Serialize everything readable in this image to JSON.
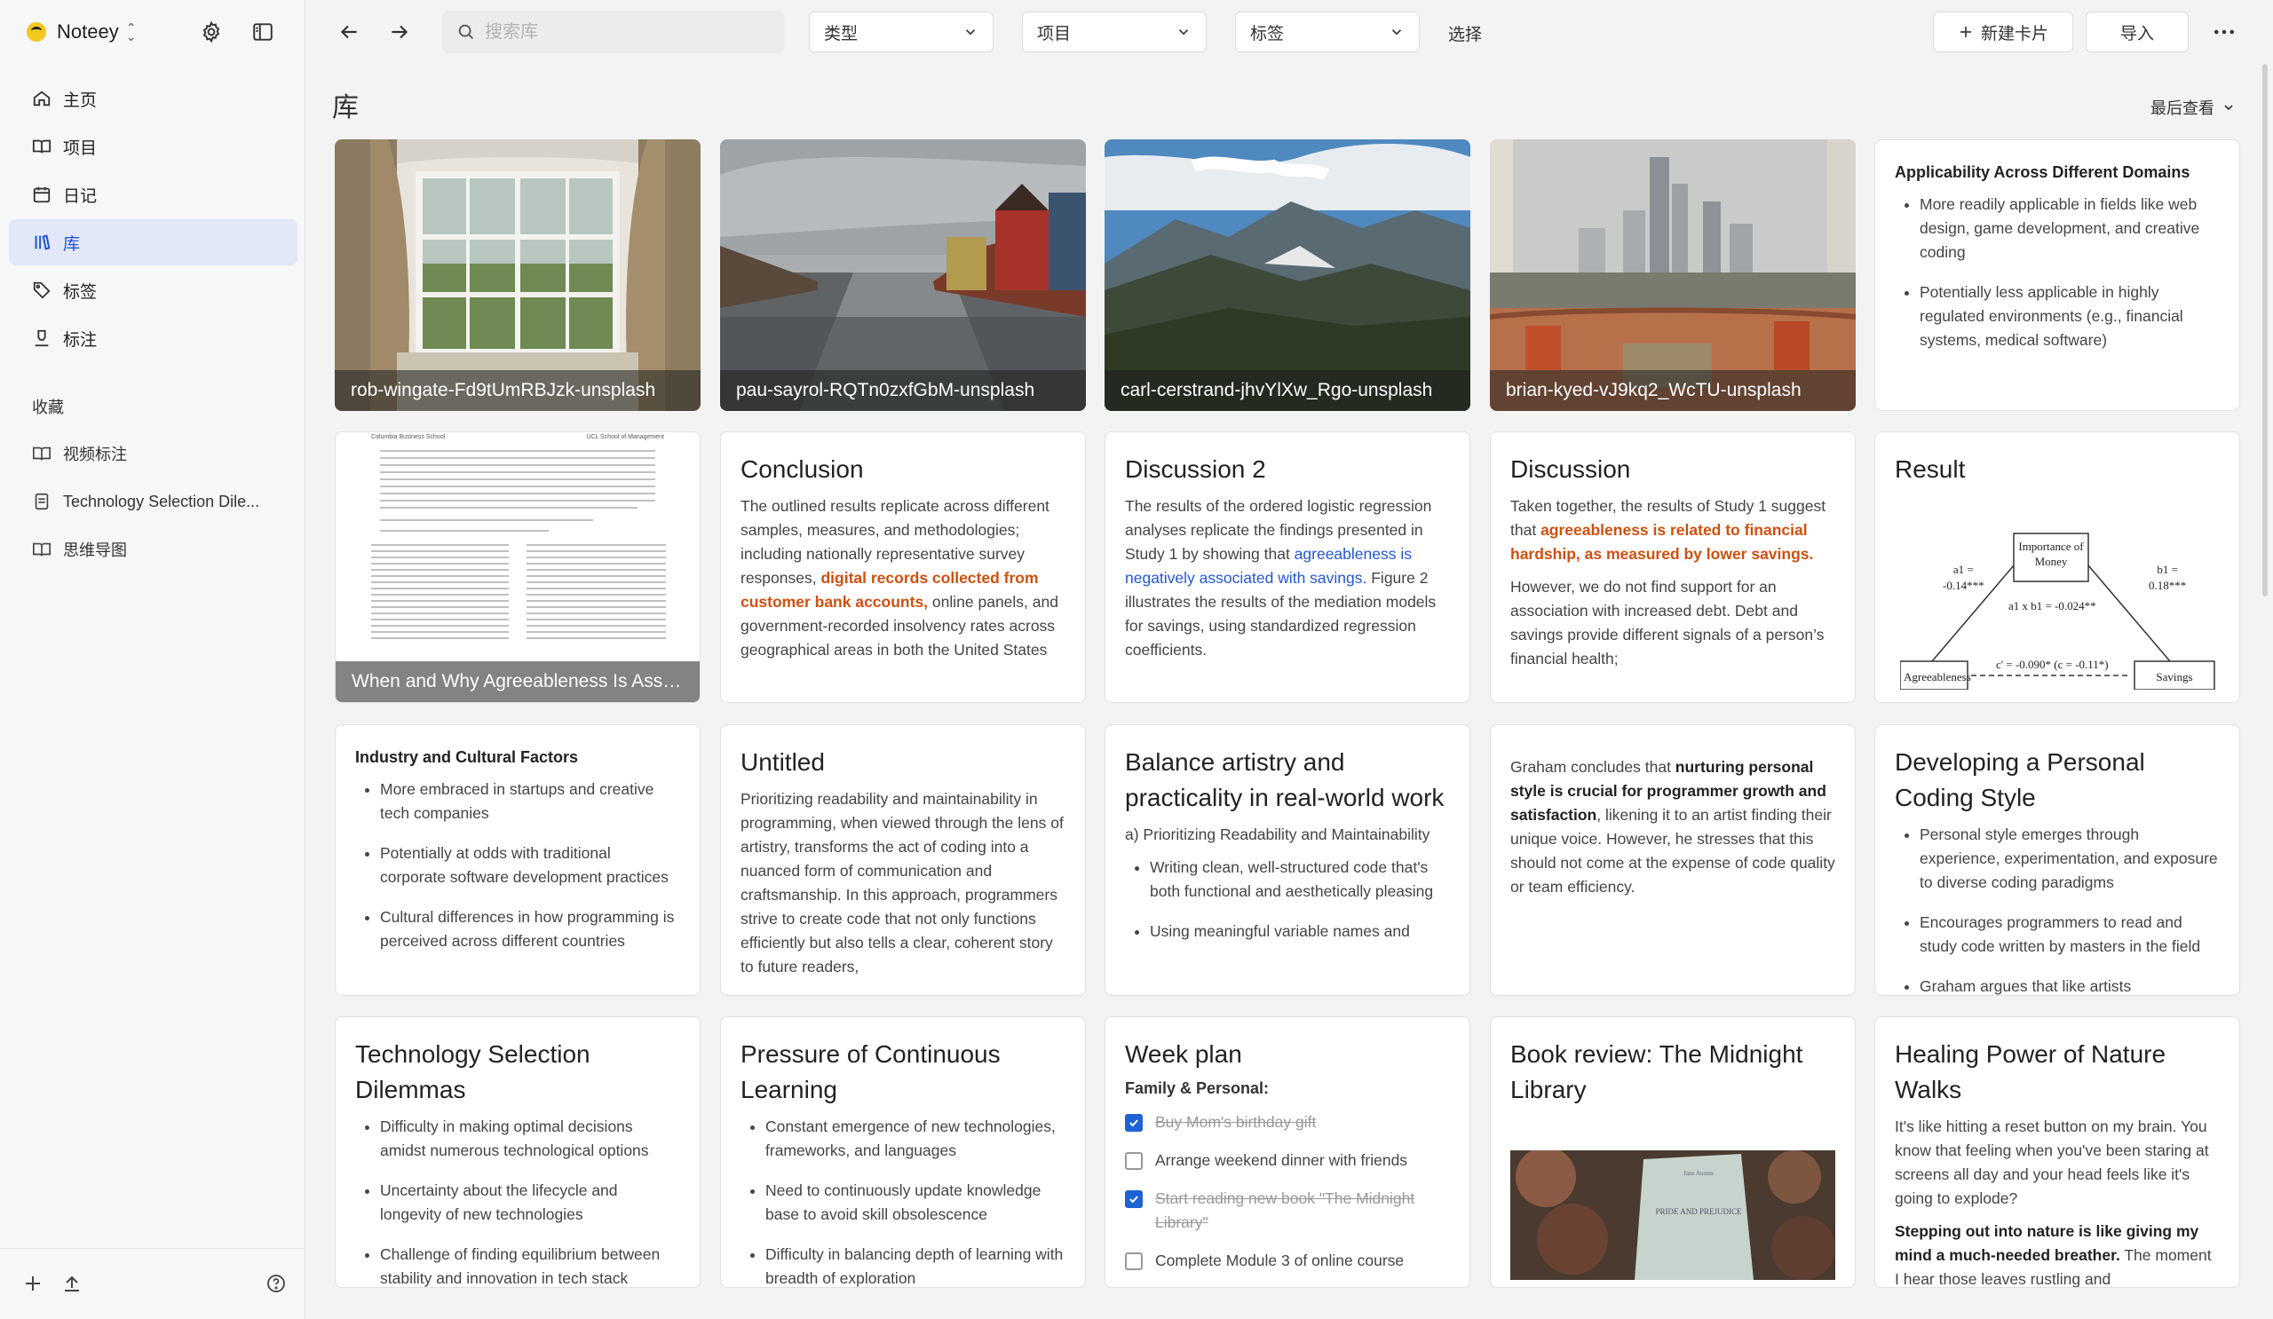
{
  "app": {
    "name": "Noteey"
  },
  "sidebar": {
    "nav": [
      {
        "label": "主页",
        "icon": "home-icon"
      },
      {
        "label": "项目",
        "icon": "book-icon"
      },
      {
        "label": "日记",
        "icon": "calendar-icon"
      },
      {
        "label": "库",
        "icon": "library-icon",
        "active": true
      },
      {
        "label": "标签",
        "icon": "tag-icon"
      },
      {
        "label": "标注",
        "icon": "highlighter-icon"
      }
    ],
    "favorites_label": "收藏",
    "favorites": [
      {
        "label": "视频标注",
        "icon": "book-icon"
      },
      {
        "label": "Technology Selection Dile...",
        "icon": "document-icon"
      },
      {
        "label": "思维导图",
        "icon": "book-icon"
      }
    ]
  },
  "toolbar": {
    "search_placeholder": "搜索库",
    "filters": [
      "类型",
      "项目",
      "标签"
    ],
    "select_label": "选择",
    "new_card": "新建卡片",
    "import": "导入"
  },
  "library": {
    "title": "库",
    "sort": "最后查看"
  },
  "cards": {
    "img1": "rob-wingate-Fd9tUmRBJzk-unsplash",
    "img2": "pau-sayrol-RQTn0zxfGbM-unsplash",
    "img3": "carl-cerstrand-jhvYlXw_Rgo-unsplash",
    "img4": "brian-kyed-vJ9kq2_WcTU-unsplash",
    "app_domains": {
      "title": "Applicability Across Different Domains",
      "items": [
        "More readily applicable in fields like web design, game development, and creative coding",
        "Potentially less applicable in highly regulated environments (e.g., financial systems, medical software)"
      ]
    },
    "pdf": {
      "caption": "When and Why Agreeableness Is Associated with Savings",
      "header_left": "Columbia Business School",
      "header_right": "UCL School of Management"
    },
    "conclusion": {
      "title": "Conclusion",
      "t1": "The outlined results replicate across different samples, measures, and methodologies; including nationally representative survey responses, ",
      "hl": "digital records collected from customer bank accounts,",
      "t2": " online panels, and government-recorded insolvency rates across geographical areas in both the United States"
    },
    "discussion2": {
      "title": "Discussion 2",
      "t1": "The results of the ordered logistic regression analyses replicate the findings presented in Study 1 by showing that ",
      "hl": "agreeableness is negatively associated with savings.",
      "t2": " Figure 2 illustrates the results of the mediation models for savings, using standardized regression coefficients."
    },
    "discussion": {
      "title": "Discussion",
      "t1": "Taken together, the results of Study 1 suggest that ",
      "hl": "agreeableness is related to financial hardship, as measured by lower savings.",
      "p2": "However, we do not find support for an association with increased debt. Debt and savings provide different signals of a person’s financial health;"
    },
    "result": {
      "title": "Result",
      "box_top": "Importance of Money",
      "a1": "a1 =",
      "a1v": "-0.14***",
      "b1": "b1 =",
      "b1v": "0.18***",
      "ab": "a1 x b1 = -0.024**",
      "c": "c' = -0.090* (c = -0.11*)",
      "left": "Agreeableness",
      "right": "Savings"
    },
    "industry": {
      "title": "Industry and Cultural Factors",
      "items": [
        "More embraced in startups and creative tech companies",
        "Potentially at odds with traditional corporate software development practices",
        "Cultural differences in how programming is perceived across different countries"
      ]
    },
    "untitled": {
      "title": "Untitled",
      "text": "Prioritizing readability and maintainability in programming, when viewed through the lens of artistry, transforms the act of coding into a nuanced form of communication and craftsmanship. In this approach, programmers strive to create code that not only functions efficiently but also tells a clear, coherent story to future readers,"
    },
    "balance": {
      "title": "Balance artistry and practicality in real-world work",
      "sub": "a) Prioritizing Readability and Maintainability",
      "items": [
        "Writing clean, well-structured code that's both functional and aesthetically pleasing",
        "Using meaningful variable names and"
      ]
    },
    "graham": {
      "t1": "Graham concludes that ",
      "b": "nurturing personal style is crucial for programmer growth and satisfaction",
      "t2": ", likening it to an artist finding their unique voice. However, he stresses that this should not come at the expense of code quality or team efficiency."
    },
    "personal": {
      "title": "Developing a Personal Coding Style",
      "items": [
        "Personal style emerges through experience, experimentation, and exposure to diverse coding paradigms",
        "Encourages programmers to read and study code written by masters in the field",
        "Graham argues that like artists"
      ]
    },
    "techsel": {
      "title": "Technology Selection Dilemmas",
      "items": [
        "Difficulty in making optimal decisions amidst numerous technological options",
        "Uncertainty about the lifecycle and longevity of new technologies",
        "Challenge of finding equilibrium between stability and innovation in tech stack"
      ]
    },
    "pressure": {
      "title": "Pressure of Continuous Learning",
      "items": [
        "Constant emergence of new technologies, frameworks, and languages",
        "Need to continuously update knowledge base to avoid skill obsolescence",
        "Difficulty in balancing depth of learning with breadth of exploration"
      ]
    },
    "week": {
      "title": "Week plan",
      "sub": "Family & Personal:",
      "tasks": [
        {
          "text": "Buy Mom's birthday gift",
          "done": true
        },
        {
          "text": "Arrange weekend dinner with friends",
          "done": false
        },
        {
          "text": "Start reading new book \"The Midnight Library\"",
          "done": true
        },
        {
          "text": "Complete Module 3 of online course",
          "done": false
        }
      ]
    },
    "book": {
      "title": "Book review: The Midnight Library",
      "cover_title": "PRIDE AND PREJUDICE",
      "cover_author": "Jane Austen"
    },
    "nature": {
      "title": "Healing Power of Nature Walks",
      "p1": "It's like hitting a reset button on my brain. You know that feeling when you've been staring at screens all day and your head feels like it's going to explode?",
      "b": "Stepping out into nature is like giving my mind a much-needed breather.",
      "t2": " The moment I hear those leaves rustling and"
    }
  },
  "colors": {
    "accent": "#2253d4",
    "highlight_orange": "#d0500e",
    "highlight_blue": "#2457d6"
  }
}
